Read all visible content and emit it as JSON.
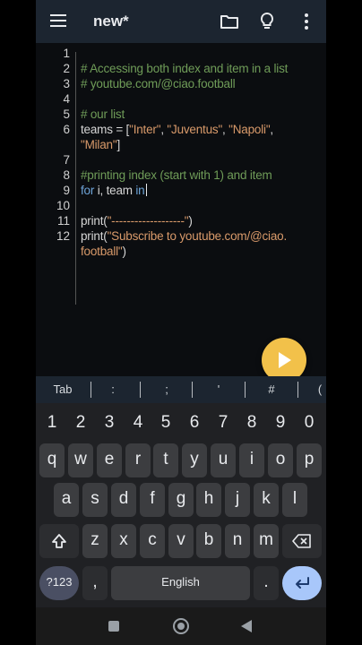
{
  "appbar": {
    "title": "new*",
    "icons": [
      "menu-icon",
      "folder-icon",
      "lightbulb-icon",
      "more-vert-icon"
    ]
  },
  "editor": {
    "line_numbers": [
      "1",
      "2",
      "3",
      "4",
      "5",
      "6",
      "",
      "7",
      "8",
      "9",
      "10",
      "11",
      "12",
      ""
    ],
    "lines": {
      "l2": "# Accessing both index and item in a list",
      "l3": "# youtube.com/@ciao.football",
      "l5": "# our list",
      "l6a": "teams = [",
      "l6s1": "\"Inter\"",
      "l6c1": ", ",
      "l6s2": "\"Juventus\"",
      "l6c2": ", ",
      "l6s3": "\"Napoli\"",
      "l6c3": ",",
      "l6bs4": "\"Milan\"",
      "l6bend": "]",
      "l8": "#printing index (start with 1) and item",
      "l9kw1": "for",
      "l9mid": " i, team ",
      "l9kw2": "in",
      "l11a": "print(",
      "l11s": "\"-------------------\"",
      "l11b": ")",
      "l12a": "print(",
      "l12s1": "\"Subscribe to youtube.com/@ciao.",
      "l12s2": "football\"",
      "l12b": ")"
    }
  },
  "symbols": [
    "Tab",
    ":",
    ";",
    "'",
    "#",
    "("
  ],
  "keyboard": {
    "numbers": [
      "1",
      "2",
      "3",
      "4",
      "5",
      "6",
      "7",
      "8",
      "9",
      "0"
    ],
    "row1": [
      "q",
      "w",
      "e",
      "r",
      "t",
      "y",
      "u",
      "i",
      "o",
      "p"
    ],
    "row2": [
      "a",
      "s",
      "d",
      "f",
      "g",
      "h",
      "j",
      "k",
      "l"
    ],
    "row3": [
      "z",
      "x",
      "c",
      "v",
      "b",
      "n",
      "m"
    ],
    "bottom": {
      "sym": "?123",
      "comma": ",",
      "space": "English",
      "period": "."
    }
  },
  "colors": {
    "appbar": "#1c2530",
    "editor_bg": "#0b0d10",
    "comment": "#6f9c58",
    "string": "#d99a6a",
    "keyword": "#6ea4d8",
    "fab": "#f2c14a",
    "keyboard": "#202124",
    "key": "#3c3d40",
    "enter": "#a8c7fa"
  }
}
